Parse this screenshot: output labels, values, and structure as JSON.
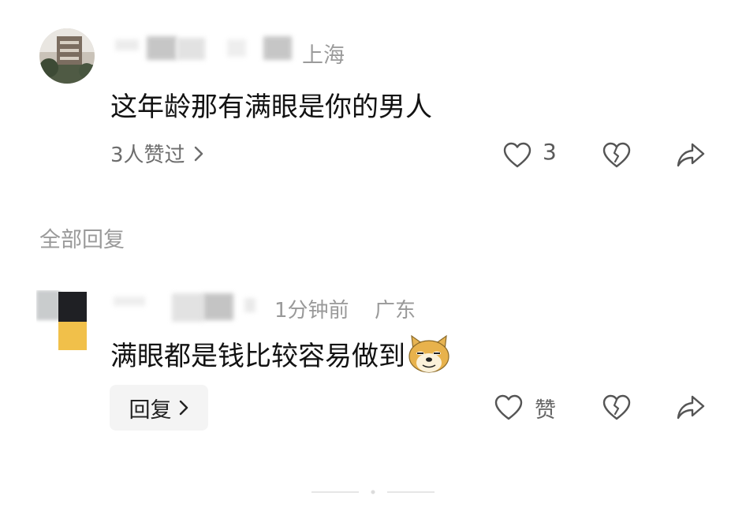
{
  "comments": [
    {
      "location": "上海",
      "text": "这年龄那有满眼是你的男人",
      "likers": "3人赞过",
      "like_count": "3"
    },
    {
      "time": "1分钟前",
      "location": "广东",
      "text": "满眼都是钱比较容易做到",
      "emoji": "doge",
      "reply_label": "回复",
      "like_label": "赞"
    }
  ],
  "section": {
    "all_replies": "全部回复"
  },
  "icons": [
    "heart-icon",
    "broken-heart-icon",
    "share-icon",
    "chevron-right-icon",
    "doge-emoji-icon"
  ],
  "colors": {
    "text": "#121212",
    "meta": "#9b9b9b",
    "icon": "#555555",
    "button_bg": "#f4f4f4"
  }
}
